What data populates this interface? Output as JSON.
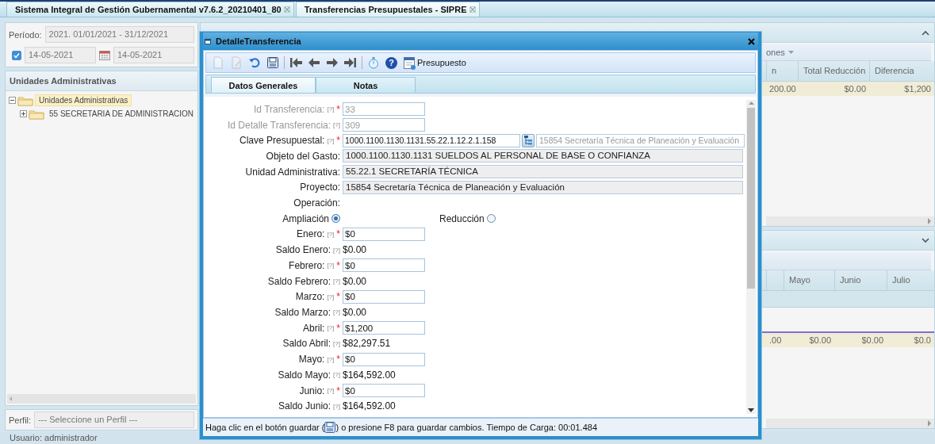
{
  "app_tabs": [
    {
      "label": "Sistema Integral de Gestión Gubernamental v7.6.2_20210401_80",
      "selected": false
    },
    {
      "label": "Transferencias Presupuestales - SIPRE",
      "selected": true
    }
  ],
  "left_panel": {
    "period_label": "Período:",
    "period_value": "2021. 01/01/2021 - 31/12/2021",
    "date_filter": {
      "checked": true,
      "from": "14-05-2021",
      "to": "14-05-2021"
    },
    "tree_title": "Unidades Administrativas",
    "tree": [
      {
        "label": "Unidades Administrativas",
        "expanded": true,
        "selected": true,
        "children": [
          {
            "label": "55 SECRETARIA DE ADMINISTRACION",
            "expanded": false,
            "selected": false
          }
        ]
      }
    ],
    "profile_label": "Perfil:",
    "profile_placeholder": "--- Seleccione un Perfil ---"
  },
  "right_panel": {
    "summary_grid": {
      "menu": "ones",
      "columns": [
        "n",
        "Total Reducción",
        "Diferencia"
      ],
      "rows": [
        [
          "200.00",
          "$0.00",
          "$1,200"
        ]
      ]
    },
    "monthly_grid": {
      "columns": [
        "Mayo",
        "Junio",
        "Julio"
      ],
      "rows": [
        [
          ".00",
          "$0.00",
          "$0.00",
          "$0.0"
        ]
      ]
    }
  },
  "dialog": {
    "title": "DetalleTransferencia",
    "toolbar": [
      {
        "kind": "new",
        "disabled": true
      },
      {
        "kind": "edit",
        "disabled": true
      },
      {
        "kind": "undo",
        "disabled": false
      },
      {
        "kind": "save",
        "disabled": false
      },
      {
        "kind": "first",
        "disabled": false
      },
      {
        "kind": "prev",
        "disabled": false
      },
      {
        "kind": "next",
        "disabled": false
      },
      {
        "kind": "last",
        "disabled": false
      },
      {
        "kind": "stopwatch",
        "disabled": false
      },
      {
        "kind": "help",
        "glyph": "?",
        "disabled": false
      },
      {
        "kind": "budget",
        "label": "Presupuesto",
        "disabled": false
      }
    ],
    "tabs": [
      {
        "label": "Datos Generales",
        "selected": true
      },
      {
        "label": "Notas",
        "selected": false
      }
    ],
    "form": [
      {
        "kind": "input",
        "label": "Id Transferencia:",
        "help": "[?]",
        "marker": "*",
        "value": "33",
        "disabled": true
      },
      {
        "kind": "input",
        "label": "Id Detalle Transferencia:",
        "help": "[?]",
        "value": "309",
        "disabled": true
      },
      {
        "kind": "lookup",
        "label": "Clave Presupuestal:",
        "help": "[?]",
        "marker": "*",
        "value": "1000.1100.1130.1131.55.22.1.12.2.1.158",
        "description": "15854 Secretaría Técnica de Planeación y Evaluación"
      },
      {
        "kind": "display",
        "label": "Objeto del Gasto:",
        "value": "1000.1100.1130.1131 SUELDOS AL PERSONAL DE BASE O CONFIANZA"
      },
      {
        "kind": "display",
        "label": "Unidad Administrativa:",
        "value": "55.22.1 SECRETARÍA TÉCNICA"
      },
      {
        "kind": "display",
        "label": "Proyecto:",
        "value": "15854 Secretaría Técnica de Planeación y Evaluación"
      },
      {
        "kind": "heading",
        "label": "Operación:"
      },
      {
        "kind": "radios",
        "options": [
          {
            "label": "Ampliación",
            "selected": true
          },
          {
            "label": "Reducción",
            "selected": false
          }
        ]
      },
      {
        "kind": "input",
        "label": "Enero:",
        "help": "[?]",
        "marker": "*",
        "value": "$0",
        "disabled": false
      },
      {
        "kind": "balance",
        "label": "Saldo Enero:",
        "help": "[?]",
        "value": "$0.00"
      },
      {
        "kind": "input",
        "label": "Febrero:",
        "help": "[?]",
        "marker": "*",
        "value": "$0",
        "disabled": false
      },
      {
        "kind": "balance",
        "label": "Saldo Febrero:",
        "help": "[?]",
        "value": "$0.00"
      },
      {
        "kind": "input",
        "label": "Marzo:",
        "help": "[?]",
        "marker": "*",
        "value": "$0",
        "disabled": false
      },
      {
        "kind": "balance",
        "label": "Saldo Marzo:",
        "help": "[?]",
        "value": "$0.00"
      },
      {
        "kind": "input",
        "label": "Abril:",
        "help": "[?]",
        "marker": "*",
        "value": "$1,200",
        "disabled": false
      },
      {
        "kind": "balance",
        "label": "Saldo Abril:",
        "help": "[?]",
        "value": "$82,297.51"
      },
      {
        "kind": "input",
        "label": "Mayo:",
        "help": "[?]",
        "marker": "*",
        "value": "$0",
        "disabled": false
      },
      {
        "kind": "balance",
        "label": "Saldo Mayo:",
        "help": "[?]",
        "value": "$164,592.00"
      },
      {
        "kind": "input",
        "label": "Junio:",
        "help": "[?]",
        "marker": "*",
        "value": "$0",
        "disabled": false
      },
      {
        "kind": "balance",
        "label": "Saldo Junio:",
        "help": "[?]",
        "value": "$164,592.00"
      }
    ],
    "footer": {
      "before_icon": "Haga clic en el botón guardar (",
      "after_icon": ") o presione F8 para guardar cambios. Tiempo de Carga: 00:01.484"
    }
  },
  "status_bar": "Usuario: administrador"
}
